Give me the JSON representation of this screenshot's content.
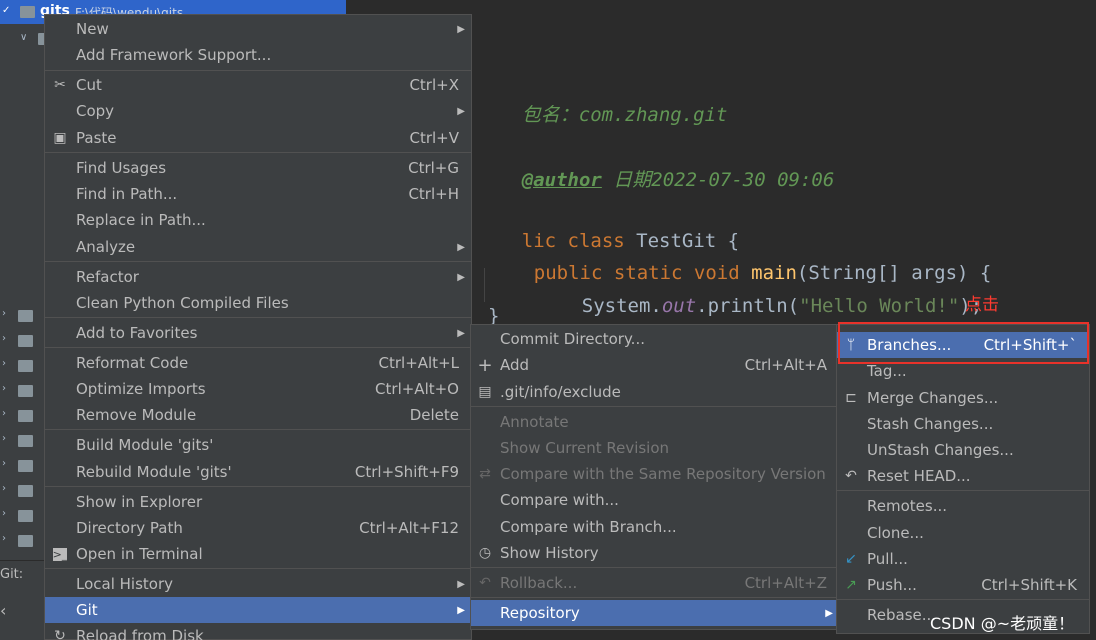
{
  "project": {
    "root_name": "gits",
    "root_path": "F:\\代码\\wendu\\gits",
    "git_label": "Git:"
  },
  "editor": {
    "line1_comment": "包名：com.zhang.git",
    "line2_tag": "@author",
    "line2_rest": " 日期2022-07-30 09:06",
    "line3_kw": "lic class",
    "line3_name": " TestGit {",
    "line4_kw": "public static void",
    "line4_fn": "main",
    "line4_rest": "(String[] args) {",
    "line5_a": "System.",
    "line5_field": "out",
    "line5_b": ".println(",
    "line5_str": "\"Hello World!\"",
    "line5_c": ");",
    "line6": "}",
    "annotation": "点击"
  },
  "context_menu": {
    "new": "New",
    "add_framework": "Add Framework Support...",
    "cut": "Cut",
    "cut_sc": "Ctrl+X",
    "copy": "Copy",
    "paste": "Paste",
    "paste_sc": "Ctrl+V",
    "find_usages": "Find Usages",
    "find_usages_sc": "Ctrl+G",
    "find_in_path": "Find in Path...",
    "find_in_path_sc": "Ctrl+H",
    "replace_in_path": "Replace in Path...",
    "analyze": "Analyze",
    "refactor": "Refactor",
    "clean_python": "Clean Python Compiled Files",
    "add_favorites": "Add to Favorites",
    "reformat": "Reformat Code",
    "reformat_sc": "Ctrl+Alt+L",
    "optimize": "Optimize Imports",
    "optimize_sc": "Ctrl+Alt+O",
    "remove_module": "Remove Module",
    "remove_module_sc": "Delete",
    "build_module": "Build Module 'gits'",
    "rebuild_module": "Rebuild Module 'gits'",
    "rebuild_module_sc": "Ctrl+Shift+F9",
    "show_explorer": "Show in Explorer",
    "directory_path": "Directory Path",
    "directory_path_sc": "Ctrl+Alt+F12",
    "open_terminal": "Open in Terminal",
    "local_history": "Local History",
    "git": "Git",
    "reload": "Reload from Disk"
  },
  "git_menu": {
    "commit_dir": "Commit Directory...",
    "add": "Add",
    "add_sc": "Ctrl+Alt+A",
    "exclude": ".git/info/exclude",
    "annotate": "Annotate",
    "show_current": "Show Current Revision",
    "compare_same": "Compare with the Same Repository Version",
    "compare_with": "Compare with...",
    "compare_branch": "Compare with Branch...",
    "show_history": "Show History",
    "rollback": "Rollback...",
    "rollback_sc": "Ctrl+Alt+Z",
    "repository": "Repository"
  },
  "repo_menu": {
    "branches": "Branches...",
    "branches_sc": "Ctrl+Shift+`",
    "tag": "Tag...",
    "merge": "Merge Changes...",
    "stash": "Stash Changes...",
    "unstash": "UnStash Changes...",
    "reset_head": "Reset HEAD...",
    "remotes": "Remotes...",
    "clone": "Clone...",
    "pull": "Pull...",
    "push": "Push...",
    "push_sc": "Ctrl+Shift+K",
    "rebase": "Rebase..."
  },
  "watermark": "CSDN @~老顽童！",
  "colors": {
    "highlight": "#4b6eaf",
    "menu_bg": "#3c3f41",
    "annotation_red": "#e8322a"
  }
}
